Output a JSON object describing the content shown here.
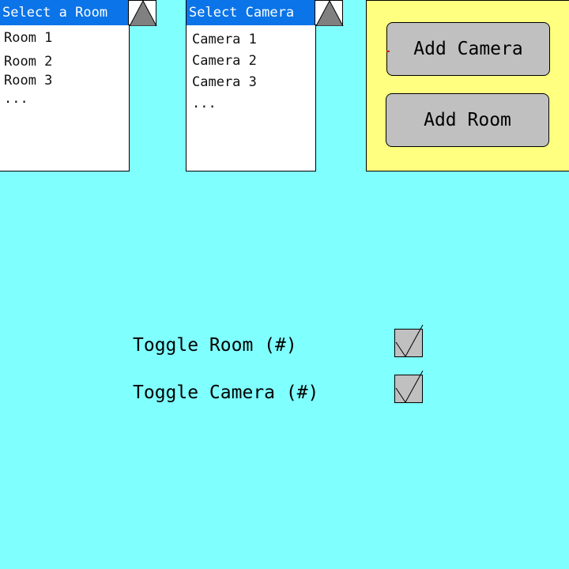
{
  "room_dropdown": {
    "header": "Select a Room",
    "items": [
      "Room 1",
      "Room 2",
      "Room 3",
      "..."
    ]
  },
  "camera_dropdown": {
    "header": "Select Camera",
    "items": [
      "Camera 1",
      "Camera 2",
      "Camera 3",
      "..."
    ]
  },
  "actions": {
    "add_camera_label": "Add Camera",
    "add_room_label": "Add Room"
  },
  "toggles": {
    "room_label": "Toggle Room (#)",
    "room_checked": true,
    "camera_label": "Toggle Camera (#)",
    "camera_checked": true
  },
  "colors": {
    "background": "#80FFFF",
    "dropdown_header": "#0A74E8",
    "panel": "#FFFF80",
    "button": "#C0C0C0",
    "arrow": "#808080"
  },
  "icons": {
    "dropdown_arrow": "triangle-up-icon",
    "checkbox": "checkmark-icon"
  }
}
